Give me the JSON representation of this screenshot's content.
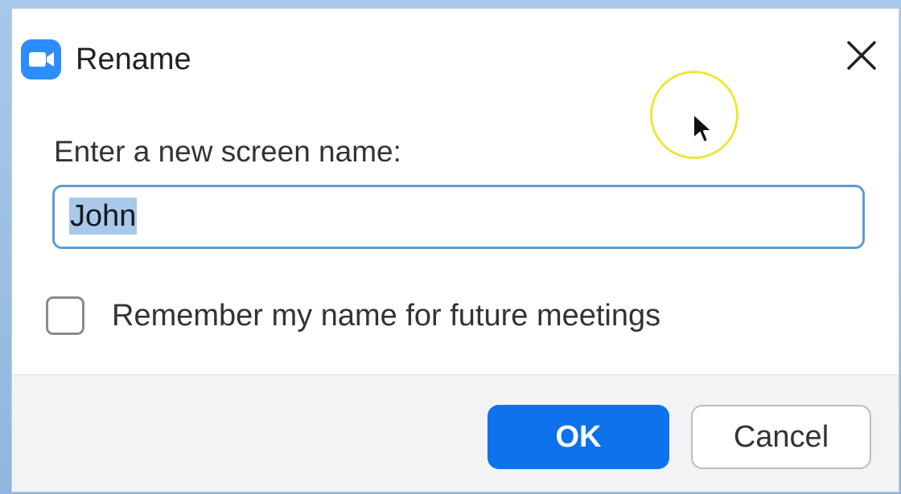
{
  "dialog": {
    "title": "Rename",
    "app_icon": "video-camera-icon",
    "close_icon": "close-icon",
    "prompt_label": "Enter a new screen name:",
    "name_input": {
      "value": "John",
      "selected": true
    },
    "remember_checkbox": {
      "label": "Remember my name for future meetings",
      "checked": false
    },
    "buttons": {
      "ok_label": "OK",
      "cancel_label": "Cancel"
    }
  },
  "colors": {
    "accent_blue": "#0e72ed",
    "app_icon_blue": "#2d8cff",
    "input_focus_border": "#5b9bd5",
    "selection_highlight": "#a9c8ea",
    "cursor_highlight_ring": "#efe63a"
  }
}
